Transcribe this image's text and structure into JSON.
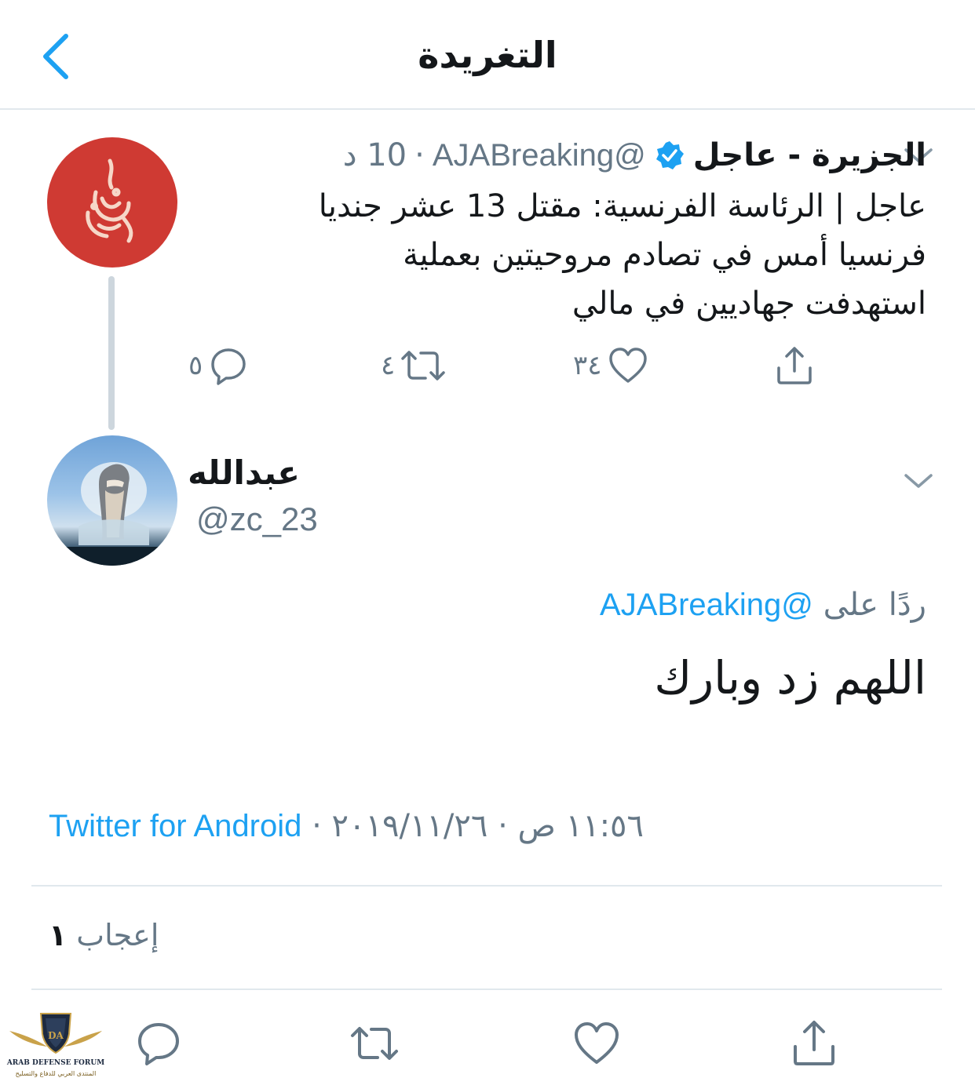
{
  "header": {
    "title": "التغريدة"
  },
  "original_tweet": {
    "display_name": "الجزيرة - عاجل",
    "handle": "@AJABreaking",
    "time": "10 د",
    "separator": "·",
    "text_lines": [
      "عاجل | الرئاسة الفرنسية: مقتل 13 عشر جنديا",
      "فرنسيا أمس في تصادم مروحيتين بعملية",
      "استهدفت جهاديين في مالي"
    ],
    "counts": {
      "replies": "٥",
      "retweets": "٤",
      "likes": "٣٤"
    }
  },
  "reply_tweet": {
    "display_name": "عبدالله",
    "handle": "@zc_23",
    "replying_prefix": "ردًا على",
    "replying_to": "@AJABreaking",
    "text": "اللهم زد وبارك",
    "time": "١١:٥٦ ص",
    "date": "٢٠١٩/١١/٢٦",
    "sep": "·",
    "source": "Twitter for Android"
  },
  "likes_summary": {
    "count": "١",
    "label": "إعجاب"
  },
  "watermark": {
    "line1": "ARAB DEFENSE FORUM",
    "line2": "المنتدى العربي للدفاع والتسليح",
    "badge": "DA"
  },
  "colors": {
    "accent": "#1da1f2",
    "secondary_text": "#657786",
    "brand_red": "#cf3a33",
    "divider": "#e1e8ed"
  },
  "icons": [
    "back-chevron-icon",
    "chevron-down-icon",
    "verified-badge-icon",
    "reply-icon",
    "retweet-icon",
    "like-icon",
    "share-icon"
  ]
}
